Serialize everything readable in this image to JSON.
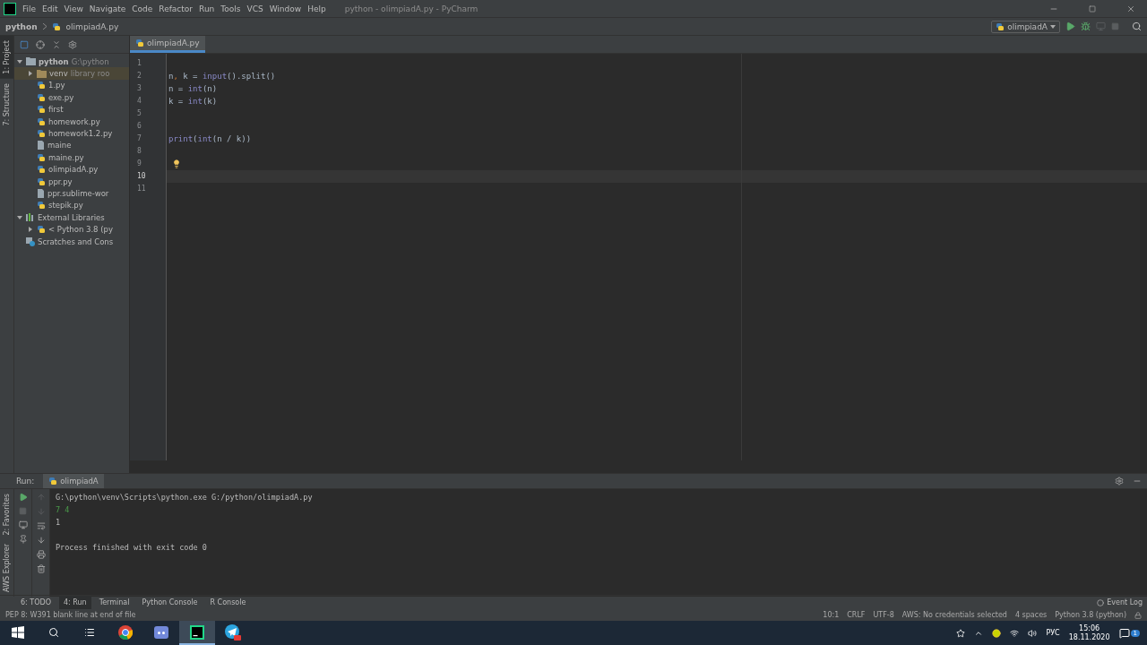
{
  "window": {
    "title": "python - olimpiadA.py - PyCharm"
  },
  "menu": [
    "File",
    "Edit",
    "View",
    "Navigate",
    "Code",
    "Refactor",
    "Run",
    "Tools",
    "VCS",
    "Window",
    "Help"
  ],
  "breadcrumbs": [
    "python",
    "olimpiadA.py"
  ],
  "run_config": {
    "label": "olimpiadA"
  },
  "left_stripe_top": [
    {
      "label": "1: Project",
      "selected": true
    },
    {
      "label": "7: Structure",
      "selected": false
    }
  ],
  "left_stripe_bottom": [
    {
      "label": "2: Favorites",
      "selected": false
    },
    {
      "label": "AWS Explorer",
      "selected": false
    }
  ],
  "project_tree": [
    {
      "label": "python",
      "hint": "G:\\python",
      "kind": "folder",
      "expanded": true,
      "children": [
        {
          "label": "venv",
          "hint": "library roo",
          "kind": "excluded",
          "expanded": false
        },
        {
          "label": "1.py",
          "kind": "py"
        },
        {
          "label": "exe.py",
          "kind": "py"
        },
        {
          "label": "first",
          "kind": "py"
        },
        {
          "label": "homework.py",
          "kind": "py"
        },
        {
          "label": "homework1.2.py",
          "kind": "py"
        },
        {
          "label": "maine",
          "kind": "text"
        },
        {
          "label": "maine.py",
          "kind": "py"
        },
        {
          "label": "olimpiadA.py",
          "kind": "py"
        },
        {
          "label": "ppr.py",
          "kind": "py"
        },
        {
          "label": "ppr.sublime-wor",
          "kind": "text"
        },
        {
          "label": "stepik.py",
          "kind": "py"
        }
      ]
    },
    {
      "label": "External Libraries",
      "kind": "libraries",
      "expanded": true,
      "children": [
        {
          "label": "< Python 3.8 (py",
          "kind": "sdk",
          "expanded": false
        }
      ]
    },
    {
      "label": "Scratches and Cons",
      "kind": "scratches"
    }
  ],
  "editor_tabs": [
    {
      "label": "olimpiadA.py",
      "selected": true
    }
  ],
  "code_lines": [
    {
      "number": "1",
      "selected": false
    },
    {
      "number": "2",
      "selected": false,
      "tokens": [
        {
          "text": "n",
          "kind": "plain"
        },
        {
          "text": ", ",
          "kind": "comma"
        },
        {
          "text": "k = ",
          "kind": "plain"
        },
        {
          "text": "input",
          "kind": "builtin"
        },
        {
          "text": "().split()",
          "kind": "plain"
        }
      ]
    },
    {
      "number": "3",
      "selected": false,
      "tokens": [
        {
          "text": "n = ",
          "kind": "plain"
        },
        {
          "text": "int",
          "kind": "builtin"
        },
        {
          "text": "(n)",
          "kind": "plain"
        }
      ]
    },
    {
      "number": "4",
      "selected": false,
      "tokens": [
        {
          "text": "k = ",
          "kind": "plain"
        },
        {
          "text": "int",
          "kind": "builtin"
        },
        {
          "text": "(k)",
          "kind": "plain"
        }
      ]
    },
    {
      "number": "5",
      "selected": false
    },
    {
      "number": "6",
      "selected": false
    },
    {
      "number": "7",
      "selected": false,
      "tokens": [
        {
          "text": "print",
          "kind": "builtin"
        },
        {
          "text": "(",
          "kind": "plain"
        },
        {
          "text": "int",
          "kind": "builtin"
        },
        {
          "text": "(n / k))",
          "kind": "plain"
        }
      ]
    },
    {
      "number": "8",
      "selected": false
    },
    {
      "number": "9",
      "selected": false,
      "bulb": true
    },
    {
      "number": "10",
      "selected": true
    },
    {
      "number": "11",
      "selected": false
    }
  ],
  "run_panel": {
    "label": "Run:",
    "tabs": [
      {
        "label": "olimpiadA",
        "selected": true
      }
    ],
    "output": [
      {
        "text": "G:\\python\\venv\\Scripts\\python.exe G:/python/olimpiadA.py",
        "kind": "command"
      },
      {
        "text": "7 4",
        "kind": "input"
      },
      {
        "text": "1",
        "kind": "stdout"
      },
      {
        "text": "Process finished with exit code 0",
        "kind": "status"
      }
    ]
  },
  "tool_tabs": [
    {
      "label": "6: TODO",
      "selected": false
    },
    {
      "label": "4: Run",
      "selected": true
    },
    {
      "label": "Terminal",
      "selected": false
    },
    {
      "label": "Python Console",
      "selected": false
    },
    {
      "label": "R Console",
      "selected": false
    }
  ],
  "event_log": "Event Log",
  "status_bar": {
    "message": "PEP 8: W391 blank line at end of file",
    "items": [
      "10:1",
      "CRLF",
      "UTF-8",
      "AWS: No credentials selected",
      "4 spaces",
      "Python 3.8 (python)"
    ]
  },
  "taskbar": {
    "apps": [
      {
        "kind": "chrome",
        "selected": false
      },
      {
        "kind": "discord",
        "selected": false
      },
      {
        "kind": "pycharm",
        "selected": true
      },
      {
        "kind": "telegram",
        "selected": false
      }
    ],
    "language": "РУС",
    "time": "15:06",
    "date": "18.11.2020",
    "notifications": "1"
  }
}
